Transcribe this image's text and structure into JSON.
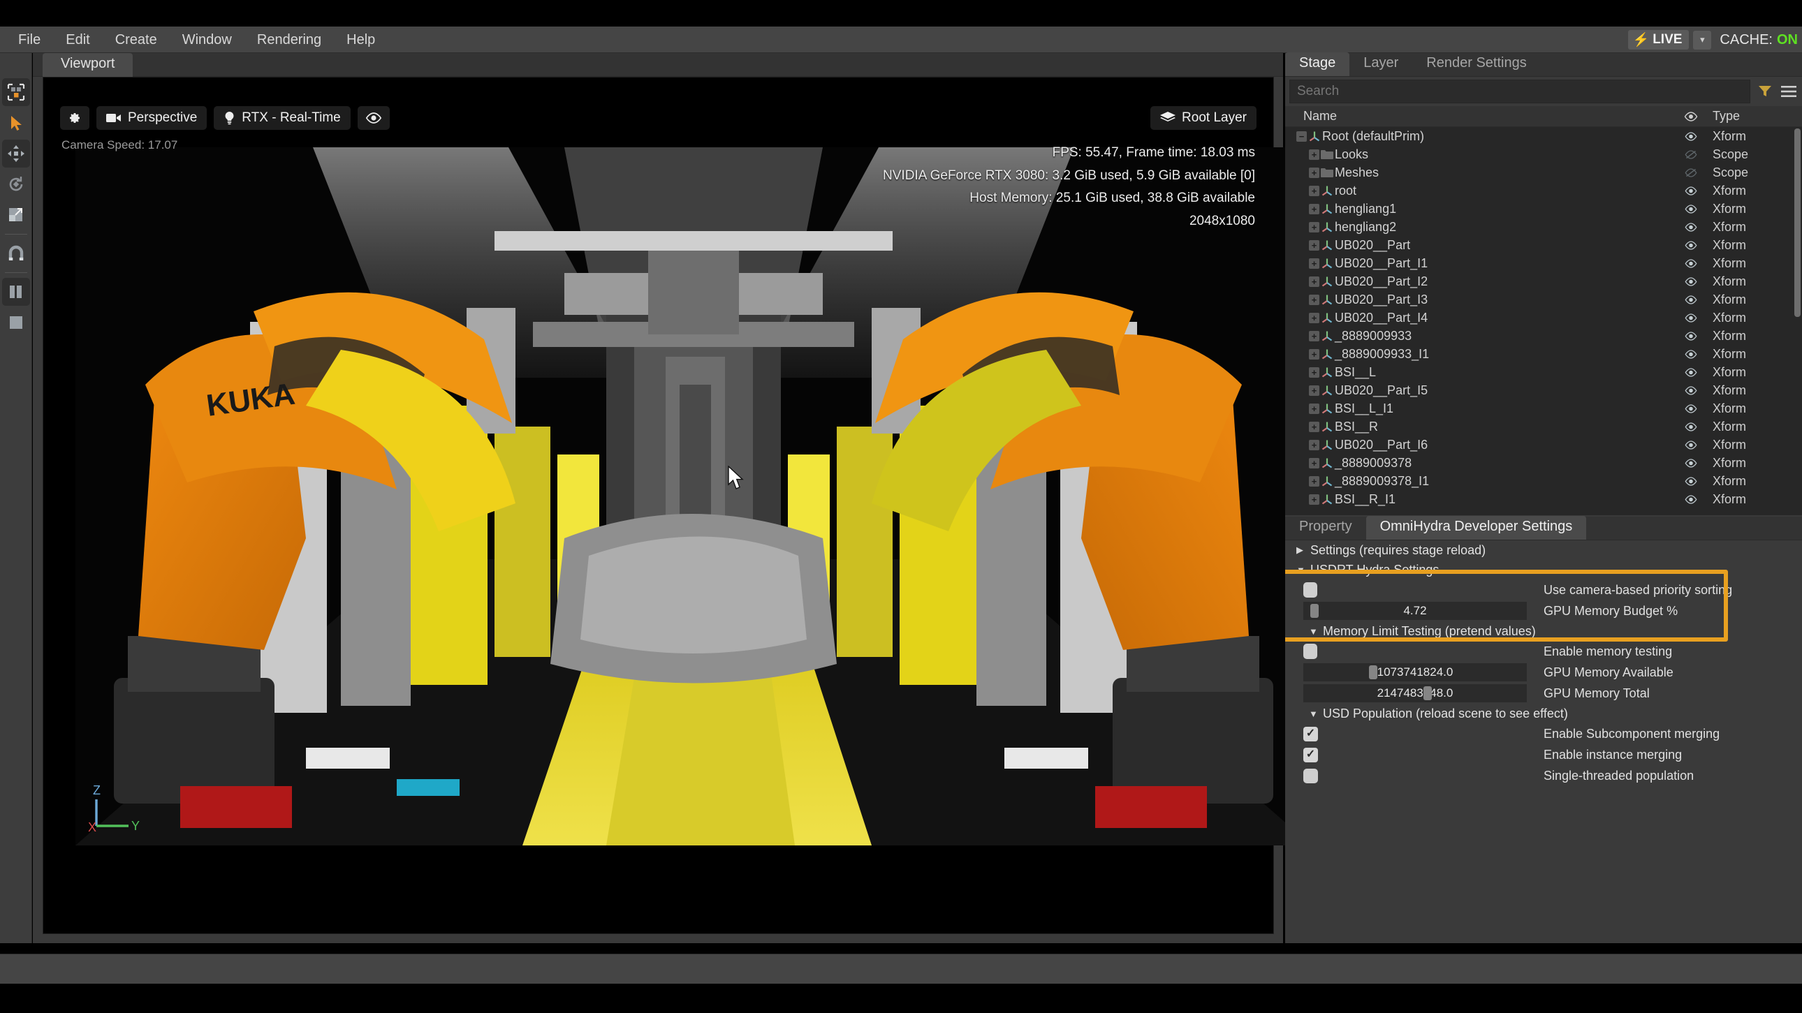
{
  "app": {
    "menu": [
      "File",
      "Edit",
      "Create",
      "Window",
      "Rendering",
      "Help"
    ],
    "live_label": "LIVE",
    "live_icon": "bolt-icon",
    "cache_label": "CACHE:",
    "cache_value": "ON"
  },
  "toolrail": {
    "items": [
      {
        "name": "select-mode-icon",
        "active": true
      },
      {
        "name": "select-arrow-icon",
        "active": false
      },
      {
        "name": "move-tool-icon",
        "active": true
      },
      {
        "name": "rotate-tool-icon",
        "active": false
      },
      {
        "name": "scale-tool-icon",
        "active": false
      },
      {
        "name": "snap-magnet-icon",
        "active": false
      },
      {
        "name": "measure-tool-icon",
        "active": true
      },
      {
        "name": "section-tool-icon",
        "active": false
      }
    ]
  },
  "viewport": {
    "tab_label": "Viewport",
    "settings_icon": "gear-icon",
    "camera_icon": "camera-icon",
    "camera_label": "Perspective",
    "renderer_icon": "lightbulb-icon",
    "renderer_label": "RTX - Real-Time",
    "visibility_icon": "eye-icon",
    "root_layer_icon": "layers-icon",
    "root_layer_label": "Root Layer",
    "camera_speed": "Camera Speed: 17.07",
    "hud": [
      "FPS: 55.47, Frame time: 18.03 ms",
      "NVIDIA GeForce RTX 3080: 3.2 GiB used,  5.9 GiB available [0]",
      "Host Memory: 25.1 GiB used, 38.8 GiB available",
      "2048x1080"
    ],
    "axis": {
      "x": "X",
      "y": "Y",
      "z": "Z"
    },
    "scene_brand_text": "KUKA"
  },
  "stage": {
    "tabs": [
      {
        "label": "Stage",
        "active": true
      },
      {
        "label": "Layer",
        "active": false
      },
      {
        "label": "Render Settings",
        "active": false
      }
    ],
    "search_placeholder": "Search",
    "filter_icon": "filter-icon",
    "options_icon": "hamburger-icon",
    "columns": {
      "name": "Name",
      "visibility": "eye-icon",
      "type": "Type"
    },
    "rows": [
      {
        "label": "Root (defaultPrim)",
        "type": "Xform",
        "depth": 0,
        "expander": "minus",
        "icon": "xform-axis-icon",
        "visible": true
      },
      {
        "label": "Looks",
        "type": "Scope",
        "depth": 1,
        "expander": "plus",
        "icon": "folder-icon",
        "visible": false
      },
      {
        "label": "Meshes",
        "type": "Scope",
        "depth": 1,
        "expander": "plus",
        "icon": "folder-icon",
        "visible": false
      },
      {
        "label": "root",
        "type": "Xform",
        "depth": 1,
        "expander": "plus",
        "icon": "xform-axis-icon",
        "visible": true
      },
      {
        "label": "hengliang1",
        "type": "Xform",
        "depth": 1,
        "expander": "plus",
        "icon": "xform-axis-icon",
        "visible": true
      },
      {
        "label": "hengliang2",
        "type": "Xform",
        "depth": 1,
        "expander": "plus",
        "icon": "xform-axis-icon",
        "visible": true
      },
      {
        "label": "UB020__Part",
        "type": "Xform",
        "depth": 1,
        "expander": "plus",
        "icon": "xform-axis-icon",
        "visible": true
      },
      {
        "label": "UB020__Part_I1",
        "type": "Xform",
        "depth": 1,
        "expander": "plus",
        "icon": "xform-axis-icon",
        "visible": true
      },
      {
        "label": "UB020__Part_I2",
        "type": "Xform",
        "depth": 1,
        "expander": "plus",
        "icon": "xform-axis-icon",
        "visible": true
      },
      {
        "label": "UB020__Part_I3",
        "type": "Xform",
        "depth": 1,
        "expander": "plus",
        "icon": "xform-axis-icon",
        "visible": true
      },
      {
        "label": "UB020__Part_I4",
        "type": "Xform",
        "depth": 1,
        "expander": "plus",
        "icon": "xform-axis-icon",
        "visible": true
      },
      {
        "label": "_8889009933",
        "type": "Xform",
        "depth": 1,
        "expander": "plus",
        "icon": "xform-axis-icon",
        "visible": true
      },
      {
        "label": "_8889009933_I1",
        "type": "Xform",
        "depth": 1,
        "expander": "plus",
        "icon": "xform-axis-icon",
        "visible": true
      },
      {
        "label": "BSI__L",
        "type": "Xform",
        "depth": 1,
        "expander": "plus",
        "icon": "xform-axis-icon",
        "visible": true
      },
      {
        "label": "UB020__Part_I5",
        "type": "Xform",
        "depth": 1,
        "expander": "plus",
        "icon": "xform-axis-icon",
        "visible": true
      },
      {
        "label": "BSI__L_I1",
        "type": "Xform",
        "depth": 1,
        "expander": "plus",
        "icon": "xform-axis-icon",
        "visible": true
      },
      {
        "label": "BSI__R",
        "type": "Xform",
        "depth": 1,
        "expander": "plus",
        "icon": "xform-axis-icon",
        "visible": true
      },
      {
        "label": "UB020__Part_I6",
        "type": "Xform",
        "depth": 1,
        "expander": "plus",
        "icon": "xform-axis-icon",
        "visible": true
      },
      {
        "label": "_8889009378",
        "type": "Xform",
        "depth": 1,
        "expander": "plus",
        "icon": "xform-axis-icon",
        "visible": true
      },
      {
        "label": "_8889009378_I1",
        "type": "Xform",
        "depth": 1,
        "expander": "plus",
        "icon": "xform-axis-icon",
        "visible": true
      },
      {
        "label": "BSI__R_I1",
        "type": "Xform",
        "depth": 1,
        "expander": "plus",
        "icon": "xform-axis-icon",
        "visible": true
      }
    ]
  },
  "property_dock": {
    "tabs": [
      {
        "label": "Property",
        "active": false
      },
      {
        "label": "OmniHydra Developer Settings",
        "active": true
      }
    ],
    "groups": [
      {
        "kind": "group",
        "label": "Settings (requires stage reload)",
        "caret": "collapsed"
      },
      {
        "kind": "group",
        "label": "USDRT Hydra Settings",
        "caret": "expanded"
      },
      {
        "kind": "toggle",
        "label": "Use camera-based priority sorting",
        "state": "off"
      },
      {
        "kind": "slider",
        "label": "GPU Memory Budget %",
        "value": "4.72",
        "knob_pct": 2
      },
      {
        "kind": "group",
        "label": "Memory Limit Testing (pretend values)",
        "caret": "expanded",
        "indent": 1
      },
      {
        "kind": "toggle",
        "label": "Enable memory testing",
        "state": "off"
      },
      {
        "kind": "slider",
        "label": "GPU Memory Available",
        "value": "1073741824.0",
        "knob_pct": 30
      },
      {
        "kind": "slider",
        "label": "GPU Memory Total",
        "value": "2147483648.0",
        "knob_pct": 56
      },
      {
        "kind": "group",
        "label": "USD Population (reload scene to see effect)",
        "caret": "expanded",
        "indent": 1
      },
      {
        "kind": "checkbox",
        "label": "Enable Subcomponent merging",
        "state": "on"
      },
      {
        "kind": "checkbox",
        "label": "Enable instance merging",
        "state": "on"
      },
      {
        "kind": "checkbox",
        "label": "Single-threaded population",
        "state": "off"
      }
    ],
    "highlight_color": "#e8a020"
  }
}
